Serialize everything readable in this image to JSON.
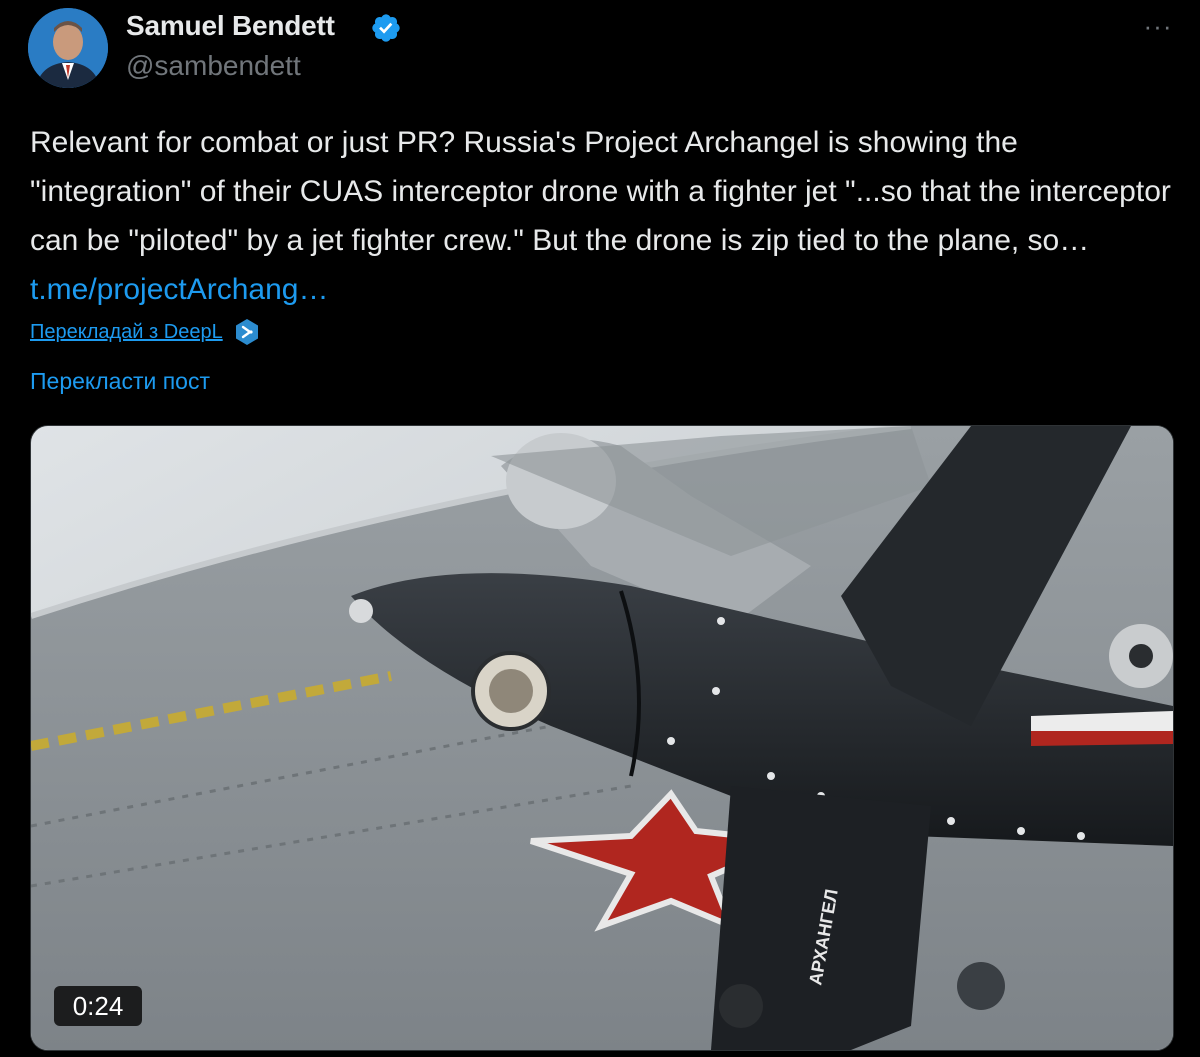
{
  "author": {
    "display_name": "Samuel Bendett",
    "handle": "@sambendett",
    "verified": true,
    "verified_icon": "verified-badge-icon"
  },
  "menu": {
    "more_icon": "more-horizontal-icon",
    "more_label": "···"
  },
  "tweet": {
    "text": "Relevant for combat or just PR? Russia's Project Archangel is showing the \"integration\" of their CUAS interceptor drone with a fighter jet \"...so that the interceptor can be \"piloted\" by a jet fighter crew.\" But the drone is zip tied to the plane, so… ",
    "link_text": "t.me/projectArchang…"
  },
  "translation": {
    "deepl_label": "Перекладай з DeepL",
    "deepl_icon": "deepl-icon",
    "translate_post_label": "Перекласти пост"
  },
  "media": {
    "type": "video",
    "duration": "0:24",
    "drone_marking": "АРХАНГЕЛ"
  },
  "colors": {
    "background": "#000000",
    "text": "#e7e9ea",
    "secondary": "#71767b",
    "link": "#1d9bf0"
  }
}
